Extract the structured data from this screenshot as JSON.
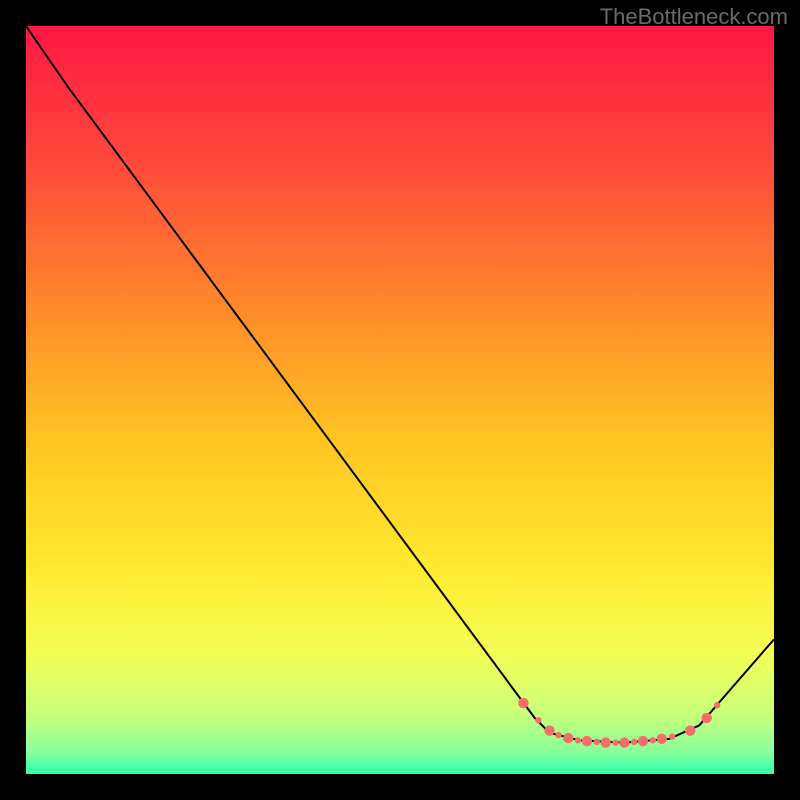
{
  "attribution": "TheBottleneck.com",
  "chart_data": {
    "type": "line",
    "title": "",
    "xlabel": "",
    "ylabel": "",
    "xlim": [
      0,
      100
    ],
    "ylim": [
      0,
      100
    ],
    "grid": false,
    "legend": false,
    "background_gradient": {
      "stops": [
        {
          "offset": 0,
          "color": "#ff1744"
        },
        {
          "offset": 20,
          "color": "#ff4f3a"
        },
        {
          "offset": 38,
          "color": "#ff8a2a"
        },
        {
          "offset": 55,
          "color": "#ffc423"
        },
        {
          "offset": 72,
          "color": "#ffe92e"
        },
        {
          "offset": 84,
          "color": "#f4ff56"
        },
        {
          "offset": 92,
          "color": "#c8ff7a"
        },
        {
          "offset": 97,
          "color": "#8aff9a"
        },
        {
          "offset": 100,
          "color": "#2dffb0"
        }
      ]
    },
    "series": [
      {
        "name": "curve",
        "color": "#000000",
        "points": [
          {
            "x": 0,
            "y": 100
          },
          {
            "x": 5.5,
            "y": 92
          },
          {
            "x": 68,
            "y": 7.5
          },
          {
            "x": 70,
            "y": 5.5
          },
          {
            "x": 74,
            "y": 4.5
          },
          {
            "x": 80,
            "y": 4.2
          },
          {
            "x": 86,
            "y": 4.7
          },
          {
            "x": 90,
            "y": 6.5
          },
          {
            "x": 100,
            "y": 18
          }
        ]
      }
    ],
    "markers": {
      "color": "#f36f6a",
      "radius_small": 3.2,
      "radius_large": 5.2,
      "points": [
        {
          "x": 66.5,
          "y": 9.5,
          "size": "large"
        },
        {
          "x": 68.5,
          "y": 7.2,
          "size": "small"
        },
        {
          "x": 70.0,
          "y": 5.8,
          "size": "large"
        },
        {
          "x": 71.2,
          "y": 5.2,
          "size": "small"
        },
        {
          "x": 72.5,
          "y": 4.8,
          "size": "large"
        },
        {
          "x": 73.8,
          "y": 4.5,
          "size": "small"
        },
        {
          "x": 75.0,
          "y": 4.4,
          "size": "large"
        },
        {
          "x": 76.3,
          "y": 4.3,
          "size": "small"
        },
        {
          "x": 77.5,
          "y": 4.2,
          "size": "large"
        },
        {
          "x": 78.8,
          "y": 4.2,
          "size": "small"
        },
        {
          "x": 80.0,
          "y": 4.2,
          "size": "large"
        },
        {
          "x": 81.3,
          "y": 4.3,
          "size": "small"
        },
        {
          "x": 82.5,
          "y": 4.4,
          "size": "large"
        },
        {
          "x": 83.8,
          "y": 4.5,
          "size": "small"
        },
        {
          "x": 85.0,
          "y": 4.7,
          "size": "large"
        },
        {
          "x": 86.4,
          "y": 5.0,
          "size": "small"
        },
        {
          "x": 88.8,
          "y": 5.8,
          "size": "large"
        },
        {
          "x": 91.0,
          "y": 7.5,
          "size": "large"
        },
        {
          "x": 92.4,
          "y": 9.2,
          "size": "small"
        }
      ]
    }
  }
}
